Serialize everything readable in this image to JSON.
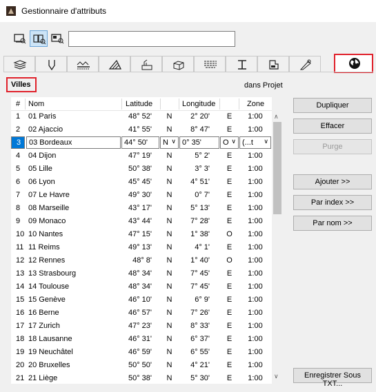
{
  "window": {
    "title": "Gestionnaire d'attributs"
  },
  "toolbar": {
    "view_buttons": [
      "list-view-icon",
      "detail-view-icon",
      "preview-view-icon"
    ],
    "search_value": ""
  },
  "tabs": [
    "layers-icon",
    "pens-icon",
    "line-types-icon",
    "fills-icon",
    "building-materials-icon",
    "composites-icon",
    "profiles-icon",
    "zones-icon",
    "operation-profiles-icon",
    "surfaces-icon",
    "cities-icon"
  ],
  "section": {
    "title": "Villes",
    "scope": "dans Projet"
  },
  "table": {
    "headers": {
      "num": "#",
      "nom": "Nom",
      "latitude": "Latitude",
      "longitude": "Longitude",
      "zone": "Zone"
    },
    "selected": {
      "num": "3",
      "nom": "03 Bordeaux",
      "lat": "44° 50'",
      "ns": "N",
      "lon": "0° 35'",
      "ew": "O",
      "zone": "(...t"
    },
    "rows": [
      {
        "num": "1",
        "nom": "01 Paris",
        "lat": "48° 52'",
        "ns": "N",
        "lon": "2° 20'",
        "ew": "E",
        "zone": "1:00"
      },
      {
        "num": "2",
        "nom": "02 Ajaccio",
        "lat": "41° 55'",
        "ns": "N",
        "lon": "8° 47'",
        "ew": "E",
        "zone": "1:00"
      },
      {
        "num": "3",
        "nom": "03 Bordeaux",
        "lat": "44° 50'",
        "ns": "N",
        "lon": "0° 35'",
        "ew": "O",
        "zone": "(...t"
      },
      {
        "num": "4",
        "nom": "04 Dijon",
        "lat": "47° 19'",
        "ns": "N",
        "lon": "5° 2'",
        "ew": "E",
        "zone": "1:00"
      },
      {
        "num": "5",
        "nom": "05 Lille",
        "lat": "50° 38'",
        "ns": "N",
        "lon": "3° 3'",
        "ew": "E",
        "zone": "1:00"
      },
      {
        "num": "6",
        "nom": "06 Lyon",
        "lat": "45° 45'",
        "ns": "N",
        "lon": "4° 51'",
        "ew": "E",
        "zone": "1:00"
      },
      {
        "num": "7",
        "nom": "07 Le Havre",
        "lat": "49° 30'",
        "ns": "N",
        "lon": "0° 7'",
        "ew": "E",
        "zone": "1:00"
      },
      {
        "num": "8",
        "nom": "08 Marseille",
        "lat": "43° 17'",
        "ns": "N",
        "lon": "5° 13'",
        "ew": "E",
        "zone": "1:00"
      },
      {
        "num": "9",
        "nom": "09 Monaco",
        "lat": "43° 44'",
        "ns": "N",
        "lon": "7° 28'",
        "ew": "E",
        "zone": "1:00"
      },
      {
        "num": "10",
        "nom": "10 Nantes",
        "lat": "47° 15'",
        "ns": "N",
        "lon": "1° 38'",
        "ew": "O",
        "zone": "1:00"
      },
      {
        "num": "11",
        "nom": "11 Reims",
        "lat": "49° 13'",
        "ns": "N",
        "lon": "4° 1'",
        "ew": "E",
        "zone": "1:00"
      },
      {
        "num": "12",
        "nom": "12 Rennes",
        "lat": "48° 8'",
        "ns": "N",
        "lon": "1° 40'",
        "ew": "O",
        "zone": "1:00"
      },
      {
        "num": "13",
        "nom": "13 Strasbourg",
        "lat": "48° 34'",
        "ns": "N",
        "lon": "7° 45'",
        "ew": "E",
        "zone": "1:00"
      },
      {
        "num": "14",
        "nom": "14 Toulouse",
        "lat": "48° 34'",
        "ns": "N",
        "lon": "7° 45'",
        "ew": "E",
        "zone": "1:00"
      },
      {
        "num": "15",
        "nom": "15 Genève",
        "lat": "46° 10'",
        "ns": "N",
        "lon": "6° 9'",
        "ew": "E",
        "zone": "1:00"
      },
      {
        "num": "16",
        "nom": "16 Berne",
        "lat": "46° 57'",
        "ns": "N",
        "lon": "7° 26'",
        "ew": "E",
        "zone": "1:00"
      },
      {
        "num": "17",
        "nom": "17 Zurich",
        "lat": "47° 23'",
        "ns": "N",
        "lon": "8° 33'",
        "ew": "E",
        "zone": "1:00"
      },
      {
        "num": "18",
        "nom": "18 Lausanne",
        "lat": "46° 31'",
        "ns": "N",
        "lon": "6° 37'",
        "ew": "E",
        "zone": "1:00"
      },
      {
        "num": "19",
        "nom": "19 Neuchâtel",
        "lat": "46° 59'",
        "ns": "N",
        "lon": "6° 55'",
        "ew": "E",
        "zone": "1:00"
      },
      {
        "num": "20",
        "nom": "20 Bruxelles",
        "lat": "50° 50'",
        "ns": "N",
        "lon": "4° 21'",
        "ew": "E",
        "zone": "1:00"
      },
      {
        "num": "21",
        "nom": "21 Liège",
        "lat": "50° 38'",
        "ns": "N",
        "lon": "5° 30'",
        "ew": "E",
        "zone": "1:00"
      }
    ]
  },
  "buttons": {
    "dupliquer": "Dupliquer",
    "effacer": "Effacer",
    "purge": "Purge",
    "ajouter": "Ajouter >>",
    "par_index": "Par index >>",
    "par_nom": "Par nom >>",
    "enregistrer": "Enregistrer Sous TXT..."
  },
  "colors": {
    "selection": "#0078d7",
    "highlight": "#e0202a"
  }
}
